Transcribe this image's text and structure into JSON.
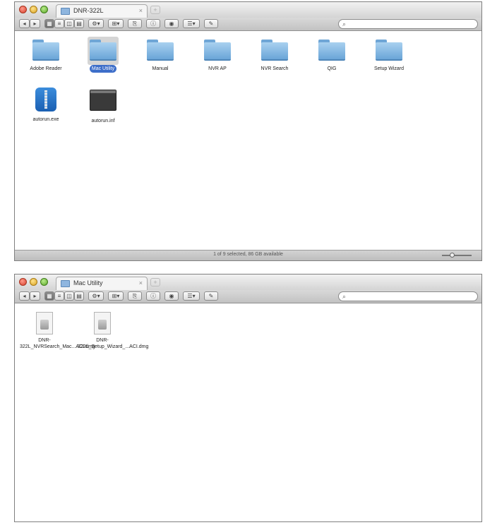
{
  "window1": {
    "tab_title": "DNR-322L",
    "tab_close": "×",
    "new_tab": "+",
    "toolbar": {
      "back": "◂",
      "forward": "▸",
      "view_icon": "▦",
      "view_list": "≡",
      "view_columns": "◫",
      "view_coverflow": "▤",
      "action": "⚙▾",
      "arrange": "⊞▾",
      "share": "⎘",
      "info": "ⓘ",
      "preview": "◉",
      "path": "☰▾",
      "edit_tags": "✎",
      "search_glyph": "⌕"
    },
    "items": [
      {
        "label": "Adobe Reader",
        "icon": "folder-icon",
        "selected": false
      },
      {
        "label": "Mac Utility",
        "icon": "folder-icon",
        "selected": true
      },
      {
        "label": "Manual",
        "icon": "folder-icon",
        "selected": false
      },
      {
        "label": "NVR AP",
        "icon": "folder-icon",
        "selected": false
      },
      {
        "label": "NVR Search",
        "icon": "folder-icon",
        "selected": false
      },
      {
        "label": "QIG",
        "icon": "folder-icon",
        "selected": false
      },
      {
        "label": "Setup Wizard",
        "icon": "folder-icon",
        "selected": false
      },
      {
        "label": "autorun.exe",
        "icon": "zip-app-icon",
        "selected": false
      },
      {
        "label": "autorun.inf",
        "icon": "inf-file-icon",
        "selected": false
      }
    ],
    "status_text": "1 of 9 selected, 86 GB available",
    "zoom_level": 0.35
  },
  "window2": {
    "tab_title": "Mac Utility",
    "tab_close": "×",
    "new_tab": "+",
    "toolbar": {
      "back": "◂",
      "forward": "▸",
      "view_icon": "▦",
      "view_list": "≡",
      "view_columns": "◫",
      "view_coverflow": "▤",
      "action": "⚙▾",
      "arrange": "⊞▾",
      "share": "⎘",
      "info": "ⓘ",
      "preview": "◉",
      "path": "☰▾",
      "edit_tags": "✎",
      "search_glyph": "⌕"
    },
    "items": [
      {
        "label": "DNR-322L_NVRSearch_Mac...ACI.dmg",
        "icon": "dmg-file-icon"
      },
      {
        "label": "DNR-322L_Setup_Wizard_...ACI.dmg",
        "icon": "dmg-file-icon"
      }
    ]
  }
}
